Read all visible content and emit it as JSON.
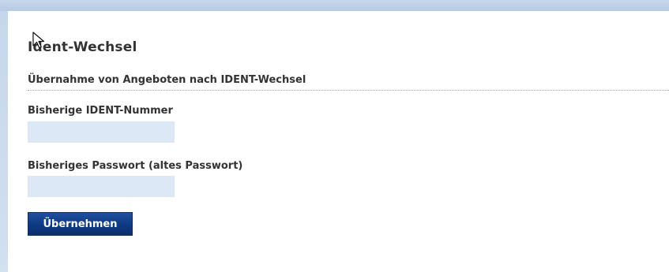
{
  "page": {
    "title": "Ident-Wechsel",
    "section_title": "Übernahme von Angeboten nach IDENT-Wechsel"
  },
  "form": {
    "old_ident_label": "Bisherige IDENT-Nummer",
    "old_ident_value": "",
    "old_password_label": "Bisheriges Passwort (altes Passwort)",
    "old_password_value": "",
    "submit_label": "Übernehmen"
  },
  "colors": {
    "frame": "#c9d9ec",
    "input_background": "#dce8f5",
    "button_background": "#0f3a83",
    "button_text": "#ffffff"
  },
  "icons": {
    "mouse_cursor": "pointer-cursor-icon"
  }
}
